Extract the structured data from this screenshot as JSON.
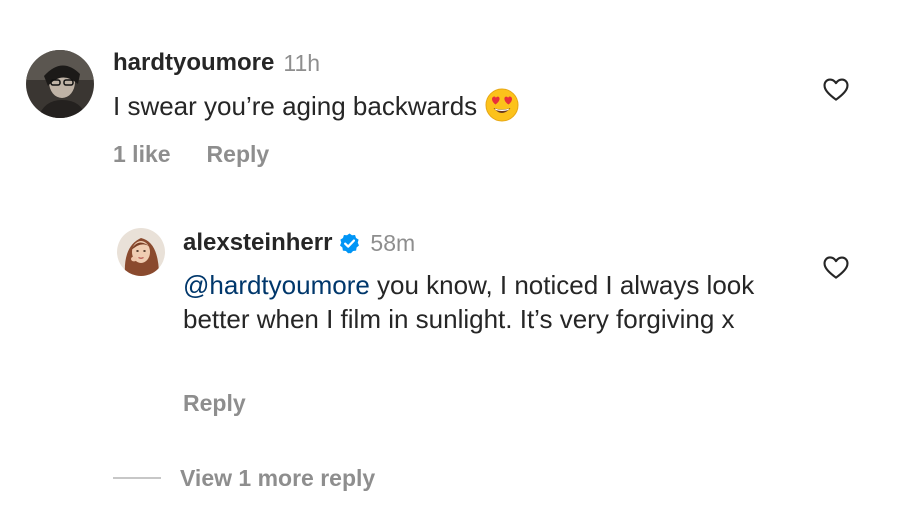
{
  "comments": [
    {
      "username": "hardtyoumore",
      "time": "11h",
      "text": "I swear you’re aging backwards",
      "emoji": "heart-eyes-emoji",
      "likes": "1 like",
      "reply_label": "Reply",
      "liked": false
    },
    {
      "username": "alexsteinherr",
      "verified": true,
      "time": "58m",
      "mention": "@hardtyoumore",
      "text": " you know, I noticed I always look better when I film in sunlight. It’s very forgiving x",
      "reply_label": "Reply",
      "liked": false
    }
  ],
  "view_more_label": "View 1 more reply",
  "colors": {
    "primary_text": "#262626",
    "secondary_text": "#8e8e8e",
    "mention": "#00376b",
    "verified": "#0095f6",
    "background": "#ffffff"
  }
}
